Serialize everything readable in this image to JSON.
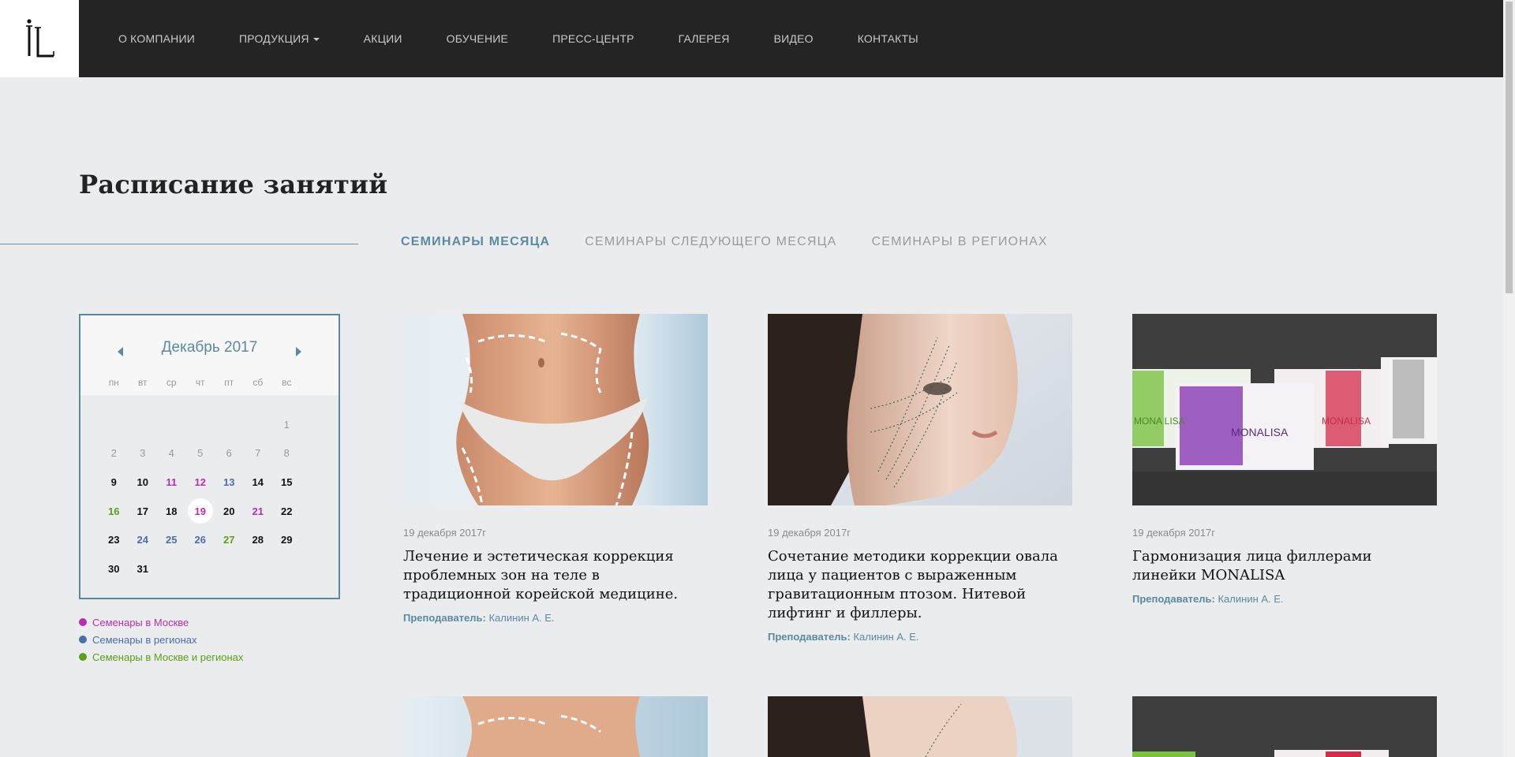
{
  "header": {
    "nav": [
      {
        "label": "О КОМПАНИИ"
      },
      {
        "label": "ПРОДУКЦИЯ"
      },
      {
        "label": "АКЦИИ"
      },
      {
        "label": "ОБУЧЕНИЕ"
      },
      {
        "label": "ПРЕСС-ЦЕНТР"
      },
      {
        "label": "ГАЛЕРЕЯ"
      },
      {
        "label": "ВИДЕО"
      },
      {
        "label": "КОНТАКТЫ"
      }
    ]
  },
  "page": {
    "title": "Расписание занятий",
    "tabs": [
      {
        "label": "СЕМИНАРЫ МЕСЯЦА"
      },
      {
        "label": "СЕМИНАРЫ СЛЕДУЮЩЕГО МЕСЯЦА"
      },
      {
        "label": "СЕМИНАРЫ В РЕГИОНАХ"
      }
    ]
  },
  "calendar": {
    "month": "Декабрь 2017",
    "weekdays": [
      "пн",
      "вт",
      "ср",
      "чт",
      "пт",
      "сб",
      "вс"
    ],
    "weeks": [
      [
        {
          "d": "",
          "t": "empty"
        },
        {
          "d": "",
          "t": "empty"
        },
        {
          "d": "",
          "t": "empty"
        },
        {
          "d": "",
          "t": "empty"
        },
        {
          "d": "",
          "t": "empty"
        },
        {
          "d": "",
          "t": "empty"
        },
        {
          "d": "1",
          "t": "muted"
        }
      ],
      [
        {
          "d": "2",
          "t": "muted"
        },
        {
          "d": "3",
          "t": "muted"
        },
        {
          "d": "4",
          "t": "muted"
        },
        {
          "d": "5",
          "t": "muted"
        },
        {
          "d": "6",
          "t": "muted"
        },
        {
          "d": "7",
          "t": "muted"
        },
        {
          "d": "8",
          "t": "muted"
        }
      ],
      [
        {
          "d": "9",
          "t": "plain"
        },
        {
          "d": "10",
          "t": "plain"
        },
        {
          "d": "11",
          "t": "moscow"
        },
        {
          "d": "12",
          "t": "moscow"
        },
        {
          "d": "13",
          "t": "regions"
        },
        {
          "d": "14",
          "t": "plain"
        },
        {
          "d": "15",
          "t": "plain"
        }
      ],
      [
        {
          "d": "16",
          "t": "both"
        },
        {
          "d": "17",
          "t": "plain"
        },
        {
          "d": "18",
          "t": "plain"
        },
        {
          "d": "19",
          "t": "today"
        },
        {
          "d": "20",
          "t": "plain"
        },
        {
          "d": "21",
          "t": "moscow"
        },
        {
          "d": "22",
          "t": "plain"
        }
      ],
      [
        {
          "d": "23",
          "t": "plain"
        },
        {
          "d": "24",
          "t": "regions"
        },
        {
          "d": "25",
          "t": "regions"
        },
        {
          "d": "26",
          "t": "regions"
        },
        {
          "d": "27",
          "t": "both"
        },
        {
          "d": "28",
          "t": "plain"
        },
        {
          "d": "29",
          "t": "plain"
        }
      ],
      [
        {
          "d": "30",
          "t": "plain"
        },
        {
          "d": "31",
          "t": "plain"
        },
        {
          "d": "",
          "t": "empty"
        },
        {
          "d": "",
          "t": "empty"
        },
        {
          "d": "",
          "t": "empty"
        },
        {
          "d": "",
          "t": "empty"
        },
        {
          "d": "",
          "t": "empty"
        }
      ]
    ]
  },
  "legend": [
    {
      "label": "Семенары в Москве",
      "color": "#b62fb2"
    },
    {
      "label": "Семенары в регионах",
      "color": "#4a6ea8"
    },
    {
      "label": "Семенары в Москве и регионах",
      "color": "#5aa018"
    }
  ],
  "cards": [
    {
      "date": "19 декабря 2017г",
      "title": "Лечение и эстетическая коррекция проблемных зон на теле в традиционной корейской медицине.",
      "teacher_label": "Преподаватель:",
      "teacher": "Калинин А. Е.",
      "image": "body-contour-image"
    },
    {
      "date": "19 декабря 2017г",
      "title": "Сочетание методики коррекции овала лица у пациентов с выраженным гравитационным птозом. Нитевой лифтинг и филлеры.",
      "teacher_label": "Преподаватель:",
      "teacher": "Калинин А. Е.",
      "image": "face-lifting-image"
    },
    {
      "date": "19 декабря 2017г",
      "title": "Гармонизация лица филлерами линейки MONALISA",
      "teacher_label": "Преподаватель:",
      "teacher": "Калинин А. Е.",
      "image": "monalisa-product-image"
    }
  ],
  "product": {
    "brand": "MONALISA",
    "brand_split": "MONA LISA"
  },
  "colors": {
    "accent": "#5a8aa0",
    "header_bg": "#242424",
    "page_bg": "#ebecee"
  }
}
